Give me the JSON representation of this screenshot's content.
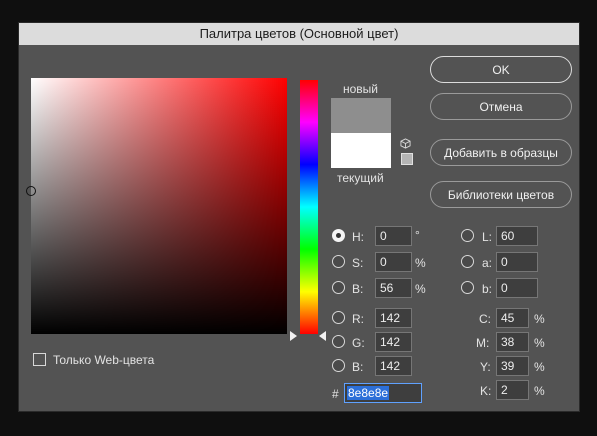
{
  "window": {
    "title": "Палитра цветов (Основной цвет)"
  },
  "buttons": {
    "ok": "OK",
    "cancel": "Отмена",
    "add_to_swatches": "Добавить в образцы",
    "color_libraries": "Библиотеки цветов"
  },
  "swatches": {
    "new_label": "новый",
    "current_label": "текущий",
    "new_color": "#8e8e8e",
    "current_color": "#ffffff"
  },
  "web_only": {
    "label": "Только Web-цвета",
    "checked": false
  },
  "hsb": [
    {
      "label": "H:",
      "value": "0",
      "unit": "°",
      "selected": true
    },
    {
      "label": "S:",
      "value": "0",
      "unit": "%",
      "selected": false
    },
    {
      "label": "B:",
      "value": "56",
      "unit": "%",
      "selected": false
    }
  ],
  "rgb": [
    {
      "label": "R:",
      "value": "142"
    },
    {
      "label": "G:",
      "value": "142"
    },
    {
      "label": "B:",
      "value": "142"
    }
  ],
  "lab": [
    {
      "label": "L:",
      "value": "60"
    },
    {
      "label": "a:",
      "value": "0"
    },
    {
      "label": "b:",
      "value": "0"
    }
  ],
  "cmyk": [
    {
      "label": "C:",
      "value": "45",
      "unit": "%"
    },
    {
      "label": "M:",
      "value": "38",
      "unit": "%"
    },
    {
      "label": "Y:",
      "value": "39",
      "unit": "%"
    },
    {
      "label": "K:",
      "value": "2",
      "unit": "%"
    }
  ],
  "hex": {
    "prefix": "#",
    "value": "8e8e8e"
  }
}
